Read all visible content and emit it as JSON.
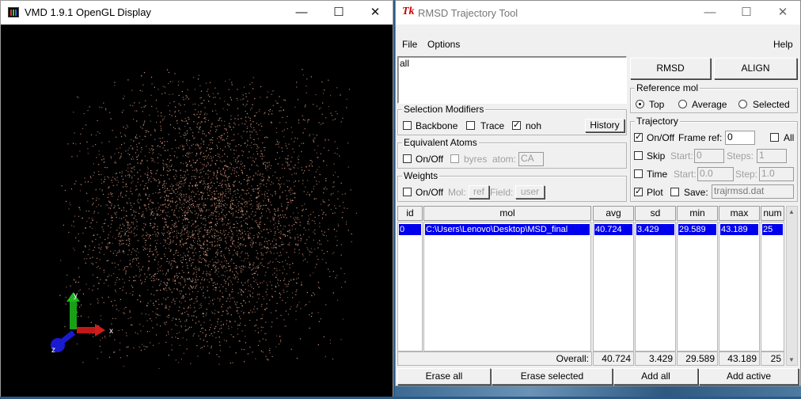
{
  "vmd": {
    "title": "VMD 1.9.1 OpenGL Display",
    "minimize": "—",
    "maximize": "☐",
    "close": "✕",
    "axes": {
      "x": "x",
      "y": "y",
      "z": "z"
    },
    "colors": {
      "background": "#000000",
      "atoms": "#e8a58a",
      "x_axis": "#c01818",
      "y_axis": "#18a018",
      "z_axis": "#1a1ad0"
    }
  },
  "rmsd": {
    "title": "RMSD Trajectory Tool",
    "tk_icon": "Tk",
    "minimize": "—",
    "maximize": "☐",
    "close": "✕",
    "menu": {
      "file": "File",
      "options": "Options",
      "help": "Help"
    },
    "selection_text": "all",
    "buttons": {
      "rmsd": "RMSD",
      "align": "ALIGN"
    },
    "selection_modifiers": {
      "title": "Selection Modifiers",
      "backbone": "Backbone",
      "backbone_checked": false,
      "trace": "Trace",
      "trace_checked": false,
      "noh": "noh",
      "noh_checked": true,
      "history": "History"
    },
    "equivalent_atoms": {
      "title": "Equivalent Atoms",
      "onoff": "On/Off",
      "onoff_checked": false,
      "byres": "byres",
      "byres_checked": false,
      "atom_label": "atom:",
      "atom_value": "CA"
    },
    "weights": {
      "title": "Weights",
      "onoff": "On/Off",
      "onoff_checked": false,
      "mol_label": "Mol:",
      "mol_value": "ref",
      "field_label": "Field:",
      "field_value": "user"
    },
    "reference_mol": {
      "title": "Reference mol",
      "options": [
        "Top",
        "Average",
        "Selected"
      ],
      "selected": "Top"
    },
    "trajectory": {
      "title": "Trajectory",
      "onoff": "On/Off",
      "onoff_checked": true,
      "frame_ref_label": "Frame ref:",
      "frame_ref_value": "0",
      "all": "All",
      "all_checked": false,
      "skip": "Skip",
      "skip_checked": false,
      "start_label": "Start:",
      "skip_start_value": "0",
      "steps_label": "Steps:",
      "steps_value": "1",
      "time": "Time",
      "time_checked": false,
      "time_start_value": "0.0",
      "step_label": "Step:",
      "step_value": "1.0",
      "plot": "Plot",
      "plot_checked": true,
      "save": "Save:",
      "save_checked": false,
      "save_file": "trajrmsd.dat"
    },
    "table": {
      "headers": [
        "id",
        "mol",
        "avg",
        "sd",
        "min",
        "max",
        "num"
      ],
      "row": {
        "id": "0",
        "mol": "C:\\Users\\Lenovo\\Desktop\\MSD_final",
        "avg": "40.724",
        "sd": "3.429",
        "min": "29.589",
        "max": "43.189",
        "num": "25"
      },
      "overall_label": "Overall:",
      "overall": {
        "avg": "40.724",
        "sd": "3.429",
        "min": "29.589",
        "max": "43.189",
        "num": "25"
      }
    },
    "bottom_buttons": {
      "erase_all": "Erase all",
      "erase_selected": "Erase selected",
      "add_all": "Add all",
      "add_active": "Add active"
    },
    "scroll_up": "▲",
    "scroll_down": "▼"
  }
}
